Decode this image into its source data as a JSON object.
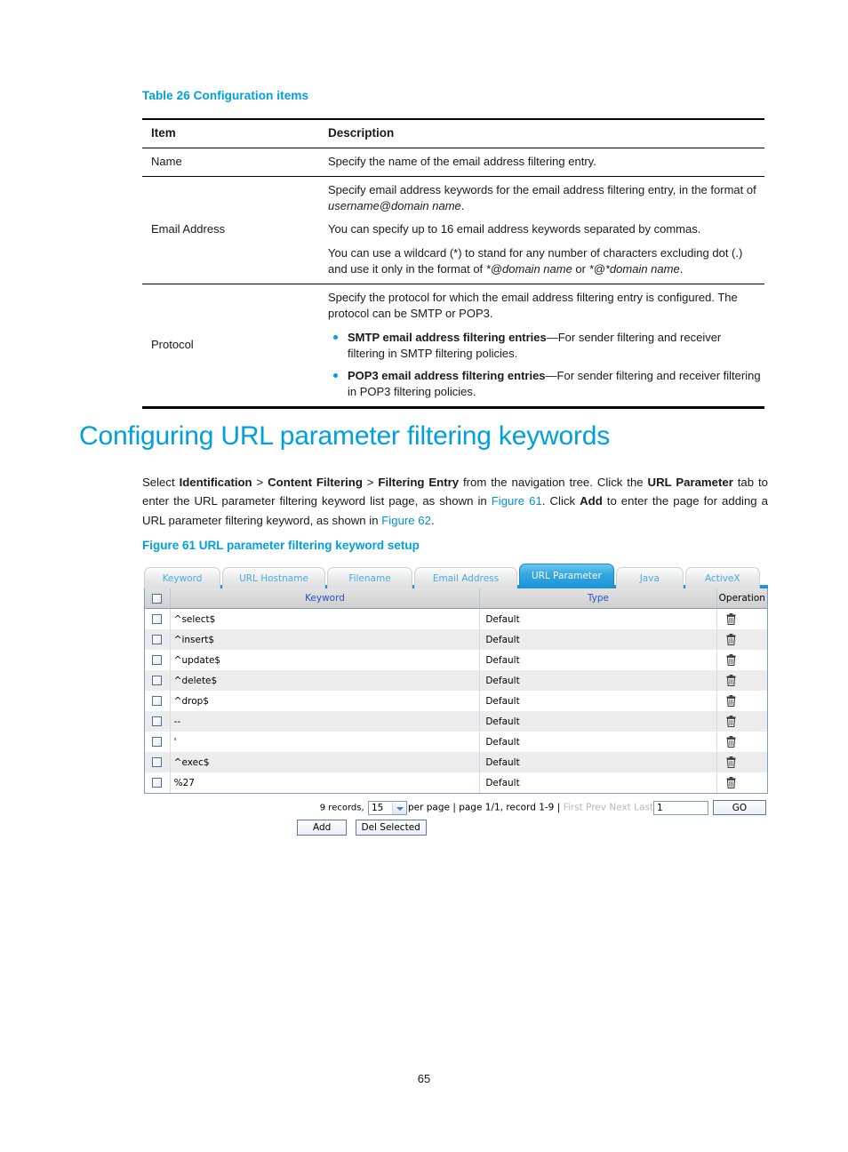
{
  "doc": {
    "table_caption": "Table 26 Configuration items",
    "config_table": {
      "headers": [
        "Item",
        "Description"
      ],
      "rows": [
        {
          "item": "Name",
          "paragraphs": [
            "Specify the name of the email address filtering entry."
          ]
        },
        {
          "item": "Email Address",
          "paragraphs": [
            "Specify email address keywords for the email address filtering entry, in the format of username@domain name.",
            "You can specify up to 16 email address keywords separated by commas.",
            "You can use a wildcard (*) to stand for any number of characters excluding dot (.) and use it only in the format of *@domain name or *@*domain name."
          ]
        },
        {
          "item": "Protocol",
          "paragraphs": [
            "Specify the protocol for which the email address filtering entry is configured. The protocol can be SMTP or POP3."
          ],
          "bullets": [
            {
              "bold": "SMTP email address filtering entries",
              "rest": "—For sender filtering and receiver filtering in SMTP filtering policies."
            },
            {
              "bold": "POP3 email address filtering entries",
              "rest": "—For sender filtering and receiver filtering in POP3 filtering policies."
            }
          ]
        }
      ]
    },
    "section_title": "Configuring URL parameter filtering keywords",
    "figure_caption": "Figure 61 URL parameter filtering keyword setup",
    "page_number": "65",
    "paragraph": {
      "p1": "Select ",
      "b1": "Identification",
      "p2": " > ",
      "b2": "Content Filtering",
      "p3": " > ",
      "b3": "Filtering Entry",
      "p4": " from the navigation tree. Click the ",
      "b4": "URL Parameter",
      "p5": " tab to enter the URL parameter filtering keyword list page, as shown in ",
      "x1": "Figure 61",
      "p6": ". Click ",
      "b5": "Add",
      "p7": " to enter the page for adding a URL parameter filtering keyword, as shown in ",
      "x2": "Figure 62",
      "p8": "."
    }
  },
  "ui": {
    "tabs": [
      {
        "label": "Keyword",
        "active": false
      },
      {
        "label": "URL Hostname",
        "active": false
      },
      {
        "label": "Filename",
        "active": false
      },
      {
        "label": "Email Address",
        "active": false
      },
      {
        "label": "URL Parameter",
        "active": true
      },
      {
        "label": "Java",
        "active": false
      },
      {
        "label": "ActiveX",
        "active": false
      }
    ],
    "grid": {
      "headers": {
        "keyword": "Keyword",
        "type": "Type",
        "operation": "Operation"
      },
      "rows": [
        {
          "keyword": "^select$",
          "type": "Default",
          "operation_icon": "trash-icon"
        },
        {
          "keyword": "^insert$",
          "type": "Default",
          "operation_icon": "trash-icon"
        },
        {
          "keyword": "^update$",
          "type": "Default",
          "operation_icon": "trash-icon"
        },
        {
          "keyword": "^delete$",
          "type": "Default",
          "operation_icon": "trash-icon"
        },
        {
          "keyword": "^drop$",
          "type": "Default",
          "operation_icon": "trash-icon"
        },
        {
          "keyword": "--",
          "type": "Default",
          "operation_icon": "trash-icon"
        },
        {
          "keyword": "'",
          "type": "Default",
          "operation_icon": "trash-icon"
        },
        {
          "keyword": "^exec$",
          "type": "Default",
          "operation_icon": "trash-icon"
        },
        {
          "keyword": "%27",
          "type": "Default",
          "operation_icon": "trash-icon"
        }
      ]
    },
    "pager": {
      "records_label": "9 records,",
      "per_page_value": "15",
      "per_page_label": "per page | page 1/1, record 1-9 |",
      "first": "First",
      "prev": "Prev",
      "next": "Next",
      "last": "Last",
      "page_input_value": "1",
      "go_label": "GO"
    },
    "actions": {
      "add": "Add",
      "del_selected": "Del Selected"
    },
    "colors": {
      "accent_blue": "#00a0dd",
      "tab_active_blue": "#1a93d6",
      "header_link_blue": "#2a4fc8",
      "grid_border": "#7f9dc0"
    }
  }
}
